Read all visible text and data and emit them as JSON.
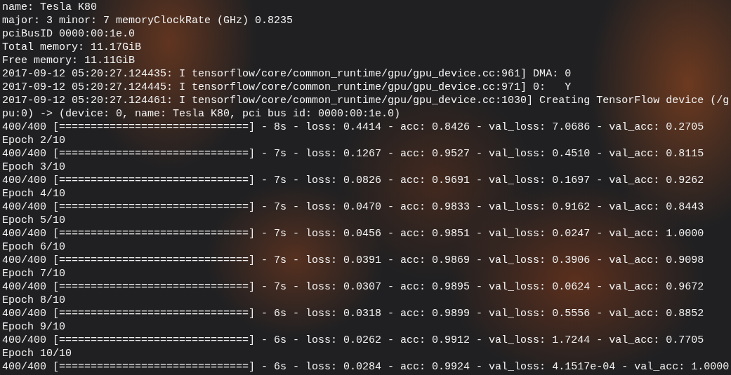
{
  "terminal": {
    "lines": [
      "name: Tesla K80",
      "major: 3 minor: 7 memoryClockRate (GHz) 0.8235",
      "pciBusID 0000:00:1e.0",
      "Total memory: 11.17GiB",
      "Free memory: 11.11GiB",
      "2017-09-12 05:20:27.124435: I tensorflow/core/common_runtime/gpu/gpu_device.cc:961] DMA: 0",
      "2017-09-12 05:20:27.124445: I tensorflow/core/common_runtime/gpu/gpu_device.cc:971] 0:   Y",
      "2017-09-12 05:20:27.124461: I tensorflow/core/common_runtime/gpu/gpu_device.cc:1030] Creating TensorFlow device (/g",
      "pu:0) -> (device: 0, name: Tesla K80, pci bus id: 0000:00:1e.0)",
      "400/400 [==============================] - 8s - loss: 0.4414 - acc: 0.8426 - val_loss: 7.0686 - val_acc: 0.2705",
      "Epoch 2/10",
      "400/400 [==============================] - 7s - loss: 0.1267 - acc: 0.9527 - val_loss: 0.4510 - val_acc: 0.8115",
      "Epoch 3/10",
      "400/400 [==============================] - 7s - loss: 0.0826 - acc: 0.9691 - val_loss: 0.1697 - val_acc: 0.9262",
      "Epoch 4/10",
      "400/400 [==============================] - 7s - loss: 0.0470 - acc: 0.9833 - val_loss: 0.9162 - val_acc: 0.8443",
      "Epoch 5/10",
      "400/400 [==============================] - 7s - loss: 0.0456 - acc: 0.9851 - val_loss: 0.0247 - val_acc: 1.0000",
      "Epoch 6/10",
      "400/400 [==============================] - 7s - loss: 0.0391 - acc: 0.9869 - val_loss: 0.3906 - val_acc: 0.9098",
      "Epoch 7/10",
      "400/400 [==============================] - 7s - loss: 0.0307 - acc: 0.9895 - val_loss: 0.0624 - val_acc: 0.9672",
      "Epoch 8/10",
      "400/400 [==============================] - 6s - loss: 0.0318 - acc: 0.9899 - val_loss: 0.5556 - val_acc: 0.8852",
      "Epoch 9/10",
      "400/400 [==============================] - 6s - loss: 0.0262 - acc: 0.9912 - val_loss: 1.7244 - val_acc: 0.7705",
      "Epoch 10/10",
      "400/400 [==============================] - 6s - loss: 0.0284 - acc: 0.9924 - val_loss: 4.1517e-04 - val_acc: 1.0000"
    ]
  }
}
